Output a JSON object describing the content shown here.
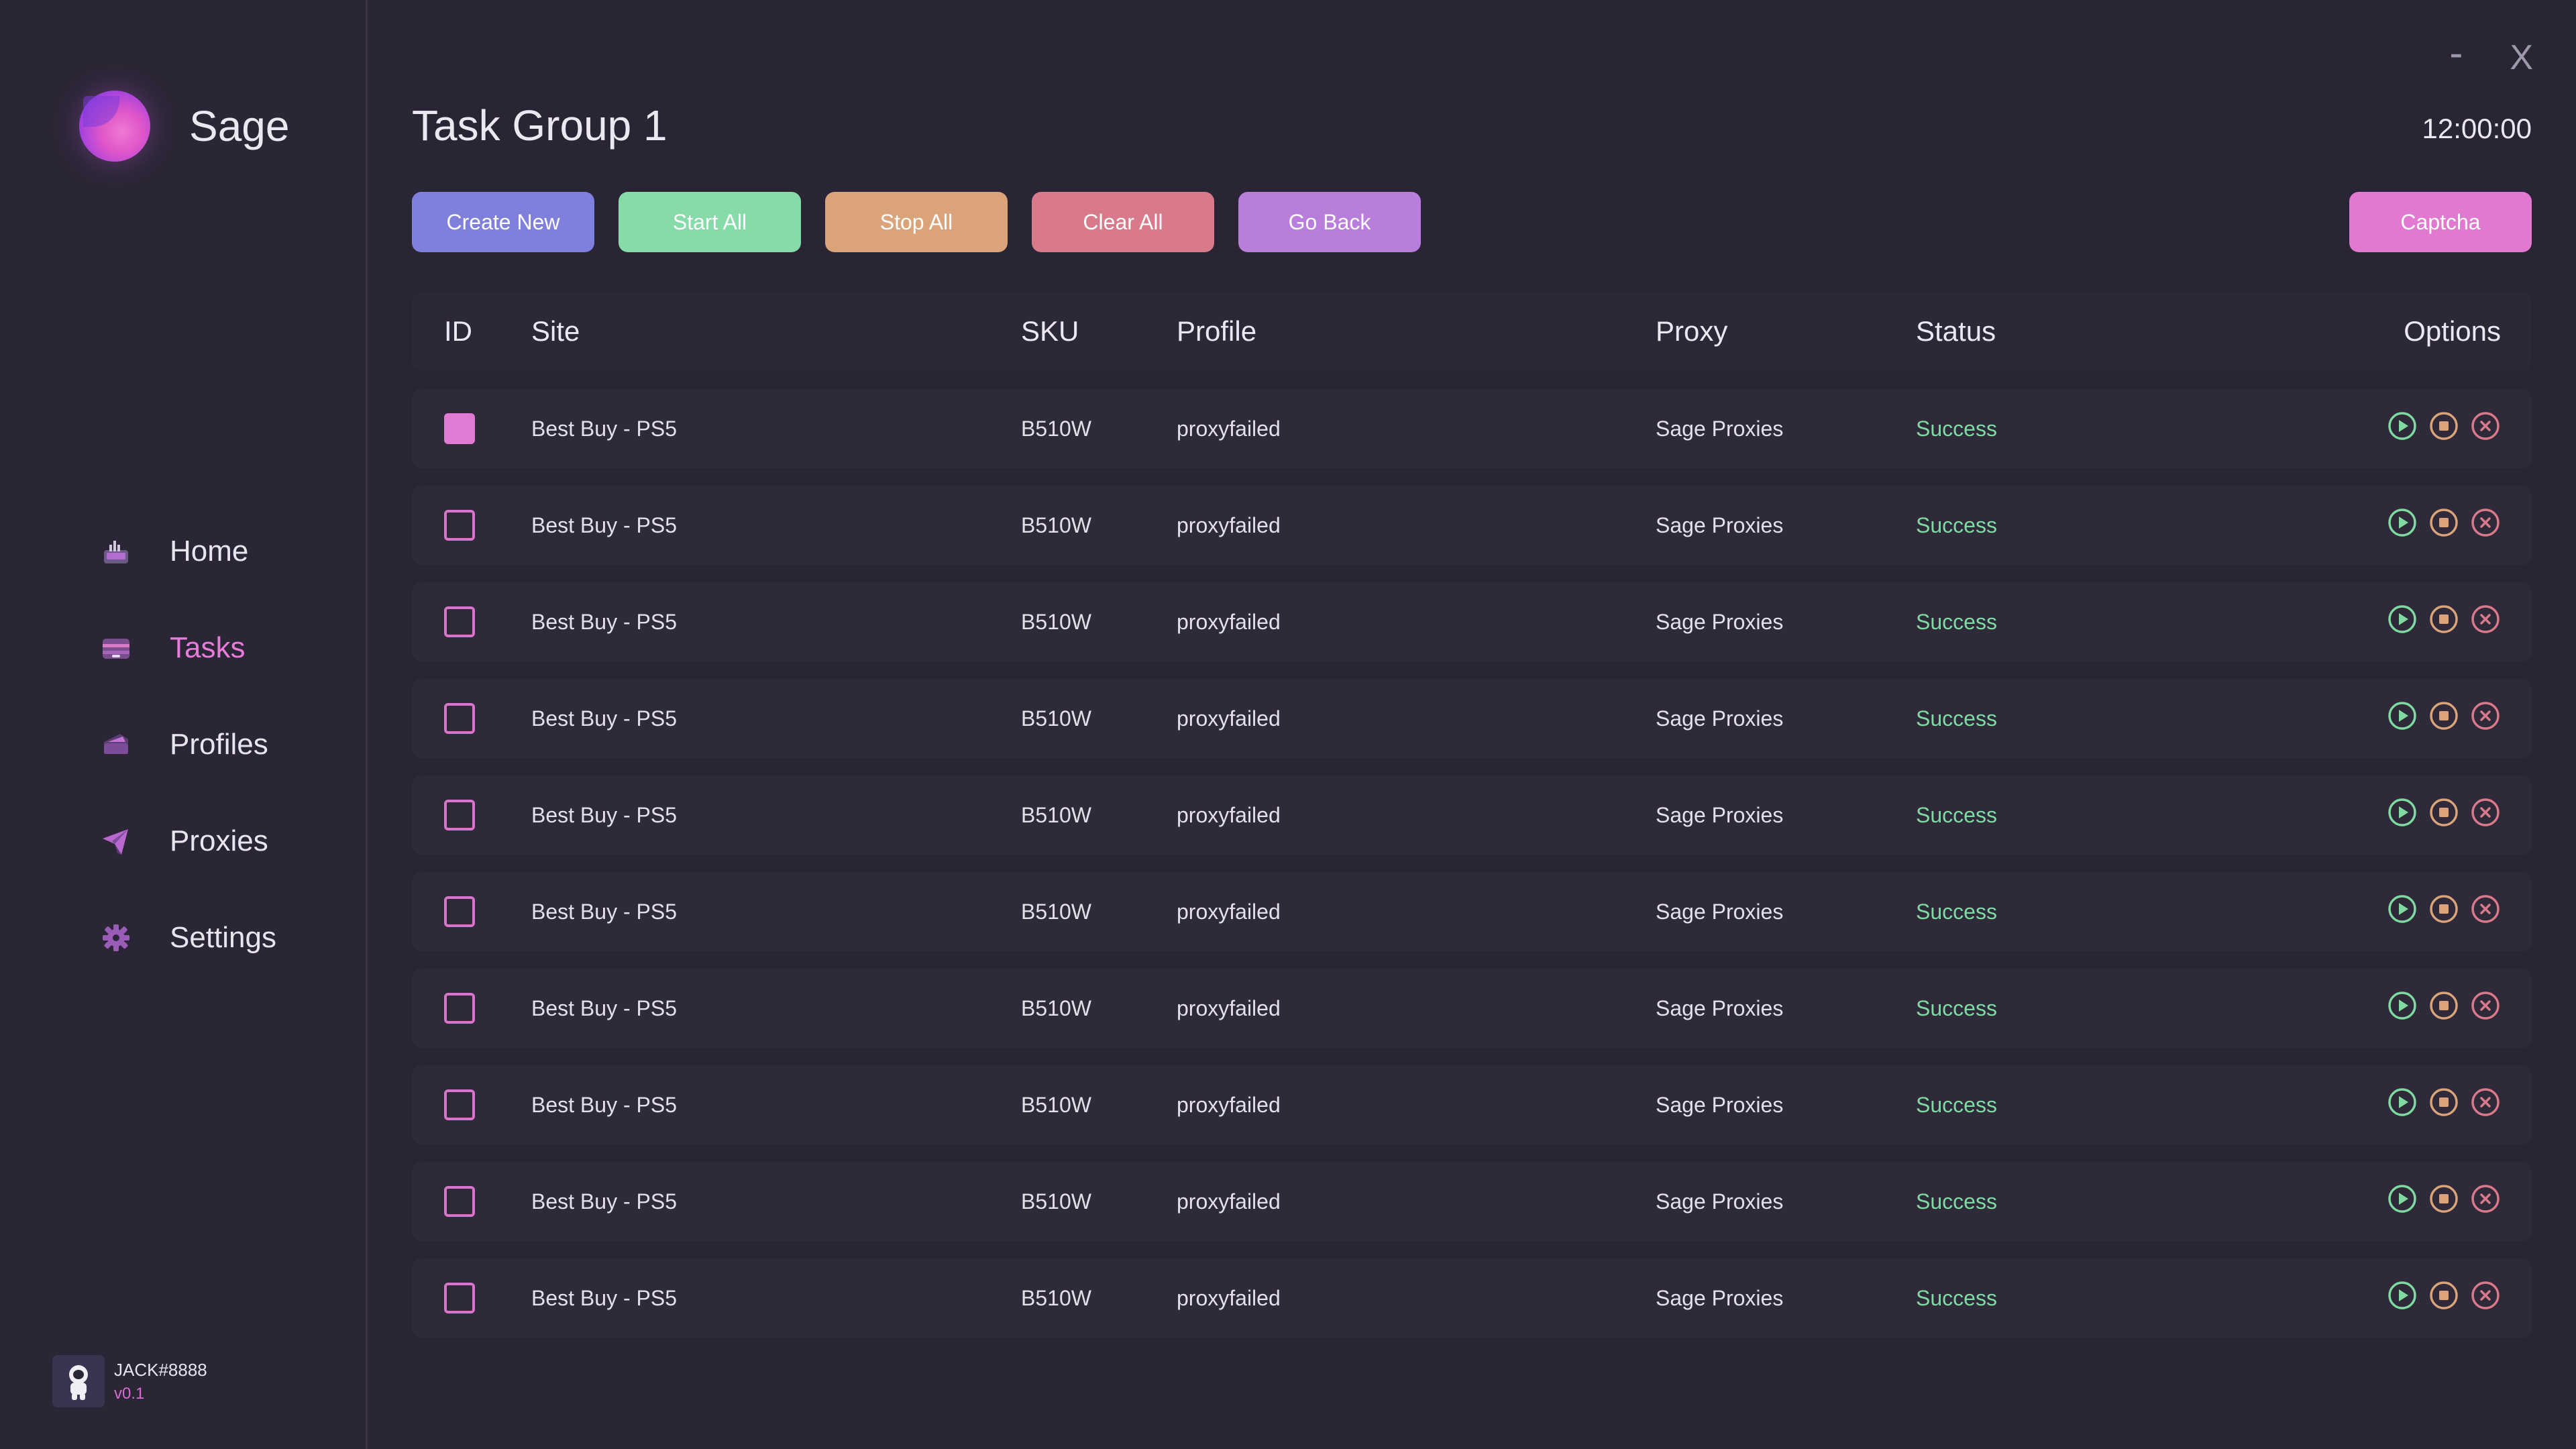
{
  "app": {
    "name": "Sage",
    "brand_color": "#e056c9"
  },
  "window": {
    "minimize_label": "-",
    "close_label": "X"
  },
  "sidebar": {
    "items": [
      {
        "label": "Home",
        "icon": "home-icon",
        "active": false
      },
      {
        "label": "Tasks",
        "icon": "tasks-icon",
        "active": true
      },
      {
        "label": "Profiles",
        "icon": "profiles-icon",
        "active": false
      },
      {
        "label": "Proxies",
        "icon": "proxies-icon",
        "active": false
      },
      {
        "label": "Settings",
        "icon": "settings-icon",
        "active": false
      }
    ]
  },
  "user": {
    "name": "JACK#8888",
    "version": "v0.1"
  },
  "header": {
    "title": "Task Group 1",
    "clock": "12:00:00"
  },
  "toolbar": {
    "create_label": "Create New",
    "start_label": "Start All",
    "stop_label": "Stop All",
    "clear_label": "Clear All",
    "back_label": "Go Back",
    "captcha_label": "Captcha"
  },
  "table": {
    "columns": [
      "ID",
      "Site",
      "SKU",
      "Profile",
      "Proxy",
      "Status",
      "Options"
    ],
    "rows": [
      {
        "checked": true,
        "site": "Best Buy - PS5",
        "sku": "B510W",
        "profile": "proxyfailed",
        "proxy": "Sage Proxies",
        "status": "Success"
      },
      {
        "checked": false,
        "site": "Best Buy - PS5",
        "sku": "B510W",
        "profile": "proxyfailed",
        "proxy": "Sage Proxies",
        "status": "Success"
      },
      {
        "checked": false,
        "site": "Best Buy - PS5",
        "sku": "B510W",
        "profile": "proxyfailed",
        "proxy": "Sage Proxies",
        "status": "Success"
      },
      {
        "checked": false,
        "site": "Best Buy - PS5",
        "sku": "B510W",
        "profile": "proxyfailed",
        "proxy": "Sage Proxies",
        "status": "Success"
      },
      {
        "checked": false,
        "site": "Best Buy - PS5",
        "sku": "B510W",
        "profile": "proxyfailed",
        "proxy": "Sage Proxies",
        "status": "Success"
      },
      {
        "checked": false,
        "site": "Best Buy - PS5",
        "sku": "B510W",
        "profile": "proxyfailed",
        "proxy": "Sage Proxies",
        "status": "Success"
      },
      {
        "checked": false,
        "site": "Best Buy - PS5",
        "sku": "B510W",
        "profile": "proxyfailed",
        "proxy": "Sage Proxies",
        "status": "Success"
      },
      {
        "checked": false,
        "site": "Best Buy - PS5",
        "sku": "B510W",
        "profile": "proxyfailed",
        "proxy": "Sage Proxies",
        "status": "Success"
      },
      {
        "checked": false,
        "site": "Best Buy - PS5",
        "sku": "B510W",
        "profile": "proxyfailed",
        "proxy": "Sage Proxies",
        "status": "Success"
      },
      {
        "checked": false,
        "site": "Best Buy - PS5",
        "sku": "B510W",
        "profile": "proxyfailed",
        "proxy": "Sage Proxies",
        "status": "Success"
      }
    ],
    "option_icons": [
      "play-icon",
      "stop-icon",
      "delete-icon"
    ]
  },
  "colors": {
    "background": "#2a2534",
    "accent": "#e07bd4",
    "success": "#7fd9a0",
    "create": "#7f7fdc",
    "start": "#86dba8",
    "stop": "#dba379",
    "clear": "#d97a8b",
    "back": "#b97ddb",
    "captcha": "#e079cf"
  }
}
